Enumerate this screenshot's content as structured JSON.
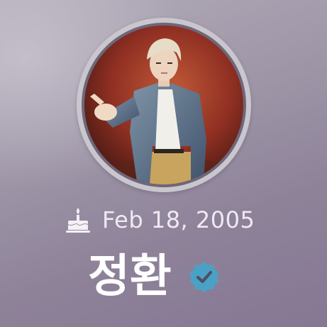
{
  "profile": {
    "birthday": "Feb 18, 2005",
    "name": "정환",
    "verified": true
  },
  "icons": {
    "birthday": "birthday-cake-icon",
    "verified": "verified-badge-icon"
  },
  "colors": {
    "verified_badge": "#49a2c6",
    "text_primary": "#ffffff",
    "text_secondary": "#eeeaf2",
    "avatar_ring": "#c9c6cd"
  }
}
